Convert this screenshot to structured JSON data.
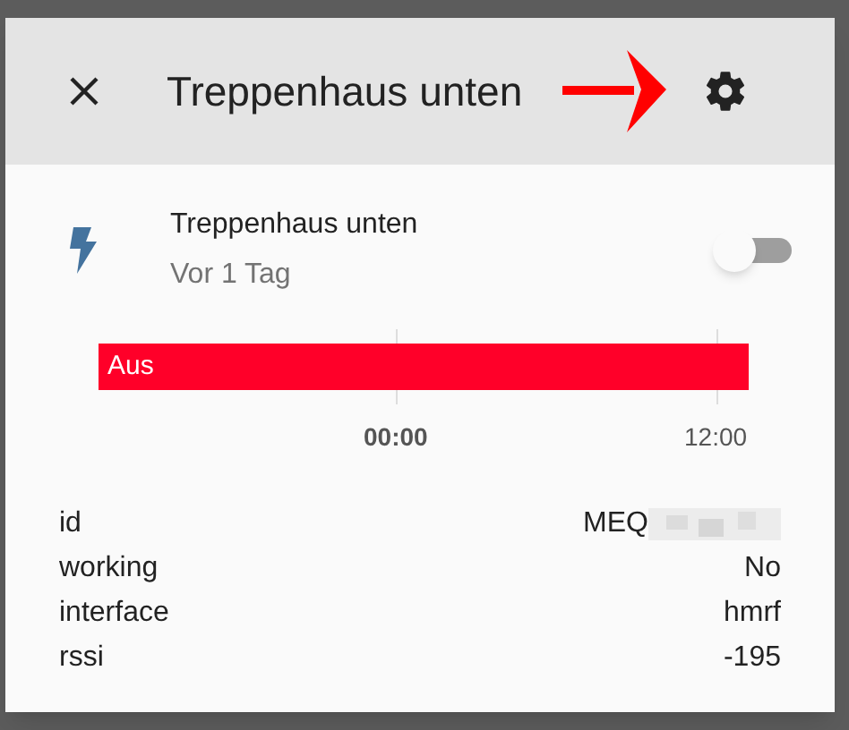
{
  "dialog": {
    "title": "Treppenhaus unten"
  },
  "entity": {
    "name": "Treppenhaus unten",
    "last_changed": "Vor 1 Tag",
    "on": false
  },
  "timeline": {
    "segments": [
      {
        "label": "Aus",
        "color": "#ff0029",
        "level": 1
      }
    ],
    "axis_labels": [
      {
        "label": "00:00",
        "bold": true
      },
      {
        "label": "12:00",
        "bold": false
      }
    ]
  },
  "attributes": [
    {
      "name": "id",
      "value": "MEQ",
      "redacted": true
    },
    {
      "name": "working",
      "value": "No",
      "redacted": false
    },
    {
      "name": "interface",
      "value": "hmrf",
      "redacted": false
    },
    {
      "name": "rssi",
      "value": "-195",
      "redacted": false
    }
  ]
}
